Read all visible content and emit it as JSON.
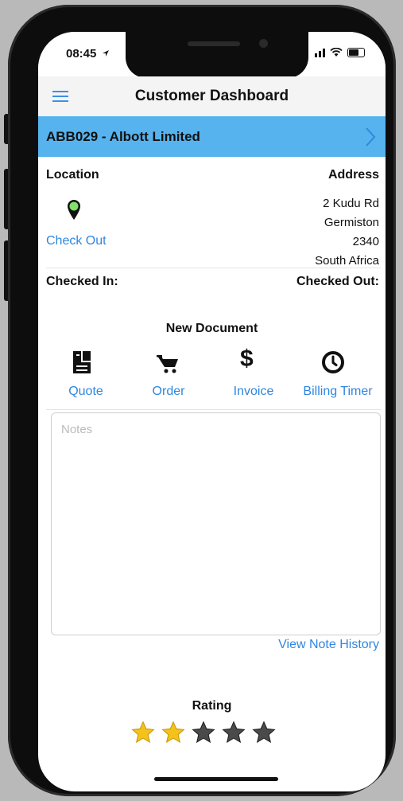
{
  "status_bar": {
    "time": "08:45"
  },
  "nav": {
    "title": "Customer Dashboard"
  },
  "customer": {
    "name": "ABB029 - Albott Limited"
  },
  "location": {
    "label": "Location",
    "action": "Check Out"
  },
  "address": {
    "label": "Address",
    "line1": "2 Kudu Rd",
    "line2": "Germiston",
    "line3": "2340",
    "line4": "South Africa"
  },
  "checkin": {
    "checked_in": "Checked In:",
    "checked_out": "Checked Out:"
  },
  "new_document": {
    "title": "New Document",
    "items": [
      {
        "label": "Quote",
        "icon": "document-icon"
      },
      {
        "label": "Order",
        "icon": "cart-icon"
      },
      {
        "label": "Invoice",
        "icon": "dollar-icon"
      },
      {
        "label": "Billing Timer",
        "icon": "clock-icon"
      }
    ]
  },
  "notes": {
    "placeholder": "Notes",
    "history_link": "View Note History"
  },
  "rating": {
    "title": "Rating",
    "value": 2,
    "max": 5
  },
  "colors": {
    "accent": "#2f86e0",
    "customer_bar": "#57b3ee",
    "pin": "#7fe06a",
    "star_on": "#f3c21b",
    "star_off": "#4a4a4a"
  }
}
